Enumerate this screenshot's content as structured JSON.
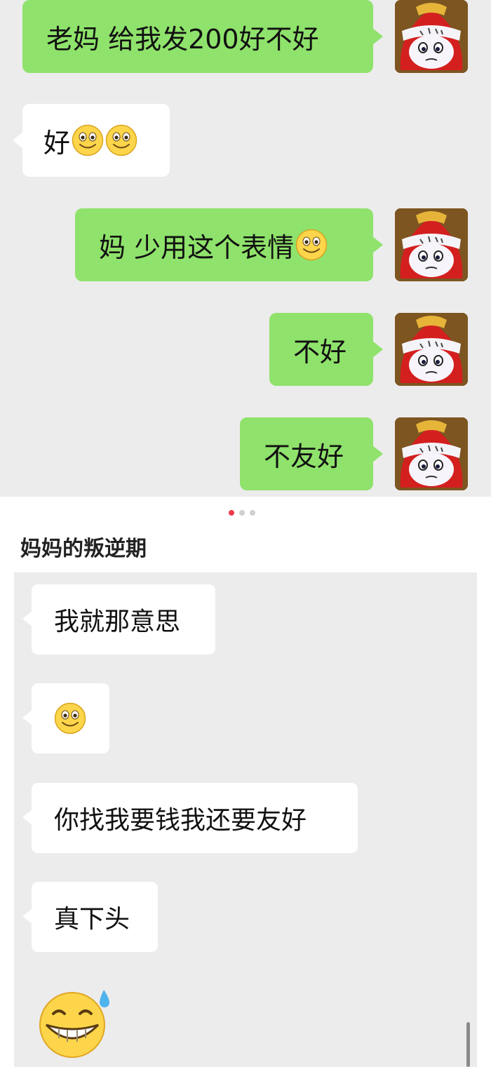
{
  "top_chat": {
    "messages": [
      {
        "sender": "me",
        "text": "老妈 给我发200好不好"
      },
      {
        "sender": "mom",
        "text": "好",
        "emojis": [
          "smile",
          "smile"
        ]
      },
      {
        "sender": "me",
        "text": "妈 少用这个表情",
        "emojis": [
          "smile"
        ]
      },
      {
        "sender": "me",
        "text": "不好"
      },
      {
        "sender": "me",
        "text": "不友好"
      }
    ]
  },
  "carousel": {
    "page_count": 3,
    "active_page": 1
  },
  "post": {
    "title": "妈妈的叛逆期"
  },
  "bottom_chat": {
    "messages": [
      {
        "sender": "mom",
        "text": "我就那意思"
      },
      {
        "sender": "mom",
        "text": "",
        "emojis": [
          "smile"
        ]
      },
      {
        "sender": "mom",
        "text": "你找我要钱我还要友好"
      },
      {
        "sender": "mom",
        "text": "真下头"
      },
      {
        "sender": "mom",
        "text": "",
        "sticker": "grin-sweat-emoji"
      }
    ]
  },
  "colors": {
    "my_bubble": "#8fe26b",
    "their_bubble": "#ffffff",
    "chat_bg": "#ececec",
    "active_dot": "#ef3a4c"
  }
}
